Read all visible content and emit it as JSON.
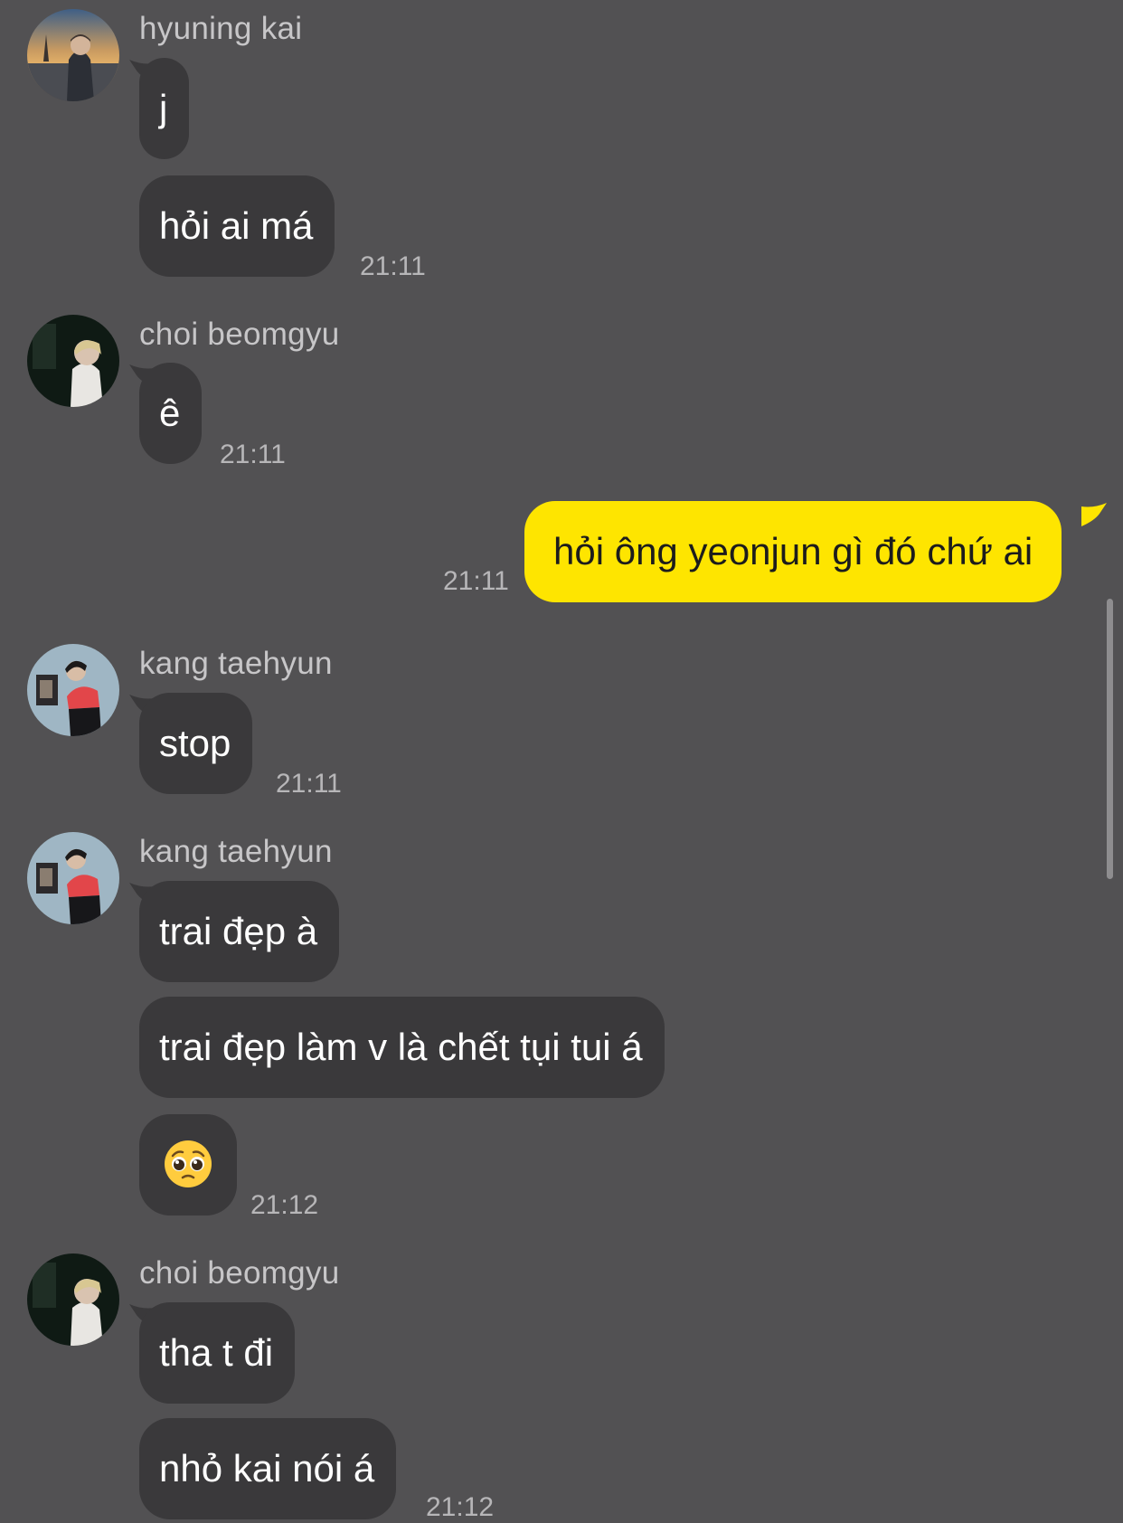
{
  "messages": [
    {
      "sender": "hyuning kai",
      "bubbles": [
        "j",
        "hỏi ai má"
      ],
      "time": "21:11"
    },
    {
      "sender": "choi beomgyu",
      "bubbles": [
        "ê"
      ],
      "time": "21:11"
    },
    {
      "sender": "",
      "bubbles": [
        "hỏi ông yeonjun gì đó chứ ai"
      ],
      "time": "21:11",
      "outgoing": true
    },
    {
      "sender": "kang taehyun",
      "bubbles": [
        "stop"
      ],
      "time": "21:11"
    },
    {
      "sender": "kang taehyun",
      "bubbles": [
        "trai đẹp à",
        "trai đẹp làm v là chết tụi tui á"
      ],
      "time": "21:12",
      "emoji": "pleading-face"
    },
    {
      "sender": "choi beomgyu",
      "bubbles": [
        "tha t đi",
        "nhỏ kai nói á"
      ],
      "time": "21:12"
    }
  ],
  "colors": {
    "background": "#525153",
    "incoming_bubble": "#3a393b",
    "outgoing_bubble": "#fee500",
    "sender_text": "#c7c6c8",
    "time_text": "#b7b6b8"
  },
  "icons": {
    "emoji": "pleading-face"
  }
}
